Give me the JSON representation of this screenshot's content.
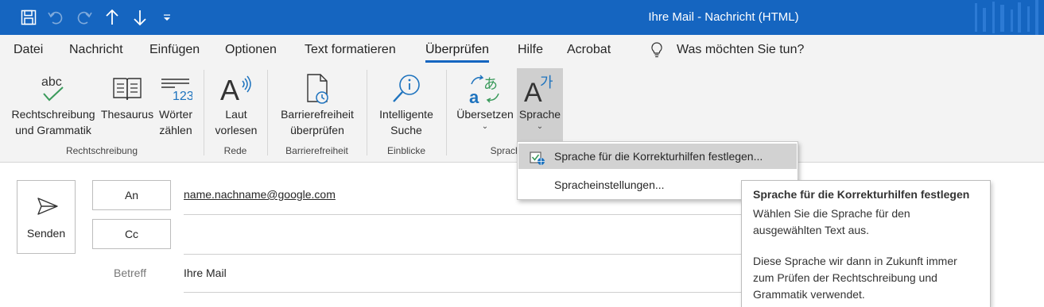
{
  "window": {
    "title": "Ihre Mail  -  Nachricht (HTML)"
  },
  "menu": [
    {
      "label": "Datei",
      "active": false
    },
    {
      "label": "Nachricht",
      "active": false
    },
    {
      "label": "Einfügen",
      "active": false
    },
    {
      "label": "Optionen",
      "active": false
    },
    {
      "label": "Text formatieren",
      "active": false
    },
    {
      "label": "Überprüfen",
      "active": true
    },
    {
      "label": "Hilfe",
      "active": false
    },
    {
      "label": "Acrobat",
      "active": false
    }
  ],
  "tell_me": {
    "label": "Was möchten Sie tun?",
    "icon": "lightbulb-icon"
  },
  "ribbon": {
    "buttons": {
      "spelling": {
        "line1": "Rechtschreibung",
        "line2": "und Grammatik",
        "icon": "spelling-check-icon"
      },
      "thesaurus": {
        "line1": "Thesaurus",
        "icon": "book-icon"
      },
      "word_count": {
        "line1": "Wörter",
        "line2": "zählen",
        "icon": "word-count-icon"
      },
      "read_aloud": {
        "line1": "Laut",
        "line2": "vorlesen",
        "icon": "read-aloud-icon"
      },
      "accessibility": {
        "line1": "Barrierefreiheit",
        "line2": "überprüfen",
        "icon": "accessibility-check-icon"
      },
      "smart_lookup": {
        "line1": "Intelligente",
        "line2": "Suche",
        "icon": "smart-lookup-icon"
      },
      "translate": {
        "line1": "Übersetzen",
        "caret": "⌄",
        "icon": "translate-icon"
      },
      "language": {
        "line1": "Sprache",
        "caret": "⌄",
        "icon": "language-icon",
        "pressed": true
      }
    },
    "groups": {
      "proofing": "Rechtschreibung",
      "speech": "Rede",
      "accessibility": "Barrierefreiheit",
      "insights": "Einblicke",
      "language": "Sprache"
    }
  },
  "language_menu": {
    "items": [
      {
        "label": "Sprache für die Korrekturhilfen festlegen...",
        "highlighted": true,
        "icon": "set-proofing-language-icon"
      },
      {
        "label": "Spracheinstellungen...",
        "highlighted": false
      }
    ]
  },
  "tooltip": {
    "title": "Sprache für die Korrekturhilfen festlegen",
    "p1": "Wählen Sie die Sprache für den ausgewählten Text aus.",
    "p2": "Diese Sprache wir dann in Zukunft immer zum Prüfen der Rechtschreibung und Grammatik verwendet."
  },
  "compose": {
    "send_label": "Senden",
    "to_label": "An",
    "cc_label": "Cc",
    "to_value": "name.nachname@google.com",
    "subject_label": "Betreff",
    "subject_value": "Ihre Mail"
  },
  "colors": {
    "accent": "#1565c0",
    "ribbon_bg": "#f3f3f3",
    "pressed": "#cfcfcf",
    "icon_blue": "#1e73be",
    "icon_green": "#3a9a5b"
  }
}
